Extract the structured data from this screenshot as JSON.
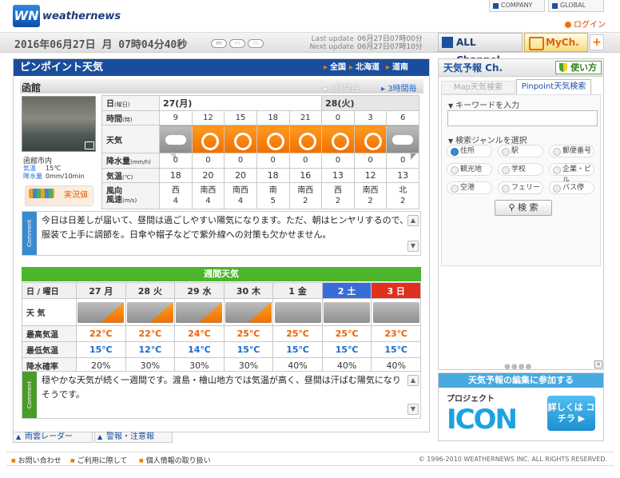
{
  "header": {
    "logo_mark": "WN",
    "logo_text": "weathernews",
    "company": "COMPANY",
    "global": "GLOBAL",
    "login": "ログイン"
  },
  "datebar": {
    "datetime": "2016年06月27日 月 07時04分40秒",
    "last_label": "Last update",
    "last_value": "06月27日07時00分",
    "next_label": "Next update",
    "next_value": "06月27日07時10分",
    "all_channel": "ALL Channel",
    "mych": "MyCh.",
    "plus": "+"
  },
  "pinpoint": {
    "title": "ピンポイント天気",
    "regions": [
      "全国",
      "北海道",
      "道南"
    ],
    "city": "函館",
    "tab_1h": "1時間毎",
    "tab_3h": "3時間毎",
    "location": "函館市内",
    "obs_temp_label": "気温",
    "obs_temp": "15℃",
    "obs_rain_label": "降水量",
    "obs_rain": "0mm/10min",
    "live_label": "実況値"
  },
  "hourly": {
    "labels": {
      "day": "日",
      "day_u": "(曜日)",
      "time": "時間",
      "time_u": "(時)",
      "weather": "天気",
      "rain": "降水量",
      "rain_u": "(mm/h)",
      "temp": "気温",
      "temp_u": "(℃)",
      "wind1": "風向",
      "wind2": "風速",
      "wind_u": "(m/s)"
    },
    "day1": "27(月)",
    "day2": "28(火)",
    "hours": [
      "9",
      "12",
      "15",
      "18",
      "21",
      "0",
      "3",
      "6"
    ],
    "weather": [
      "cloud",
      "sun",
      "sun",
      "sun",
      "sun",
      "sun",
      "sun",
      "cloud"
    ],
    "rain": [
      "0",
      "0",
      "0",
      "0",
      "0",
      "0",
      "0",
      "0"
    ],
    "temp": [
      "18",
      "20",
      "20",
      "18",
      "16",
      "13",
      "12",
      "13"
    ],
    "wind_dir": [
      "西",
      "南西",
      "南西",
      "南",
      "南西",
      "西",
      "南西",
      "北"
    ],
    "wind_speed": [
      "4",
      "4",
      "4",
      "5",
      "2",
      "2",
      "2",
      "2"
    ]
  },
  "comment1": {
    "label": "Comment",
    "text": "今日は日差しが届いて、昼間は過ごしやすい陽気になります。ただ、朝はヒンヤリするので、服装で上手に調節を。日傘や帽子などで紫外線への対策も欠かせません。"
  },
  "weekly": {
    "title": "週間天気",
    "labels": {
      "day": "日 / 曜日",
      "weather": "天 気",
      "high": "最高気温",
      "low": "最低気温",
      "rain": "降水確率"
    },
    "days": [
      "27 月",
      "28 火",
      "29 水",
      "30 木",
      "1 金",
      "2 土",
      "3 日"
    ],
    "weather": [
      "half",
      "half",
      "half",
      "half",
      "cloud",
      "cloud",
      "cloud"
    ],
    "high": [
      "22℃",
      "22℃",
      "24℃",
      "25℃",
      "25℃",
      "25℃",
      "23℃"
    ],
    "low": [
      "15℃",
      "12℃",
      "14℃",
      "15℃",
      "15℃",
      "15℃",
      "15℃"
    ],
    "rain": [
      "20%",
      "30%",
      "30%",
      "30%",
      "40%",
      "40%",
      "40%"
    ]
  },
  "comment2": {
    "label": "Comment",
    "text": "穏やかな天気が続く一週間です。渡島・檜山地方では気温が高く、昼間は汗ばむ陽気になりそうです。"
  },
  "bottom_links": [
    "雨雲レーダー",
    "警報・注意報"
  ],
  "sidebar": {
    "title": "天気予報 Ch.",
    "howto": "使い方",
    "tab_map": "Map天気検索",
    "tab_pinpoint": "Pinpoint天気検索",
    "keyword_label": "キーワードを入力",
    "genre_label": "検索ジャンルを選択",
    "genres": [
      "住所",
      "駅",
      "郵便番号",
      "観光地",
      "学校",
      "企業・ビル",
      "空港",
      "フェリー",
      "バス停"
    ],
    "search": "検 索",
    "dots": "●●●●"
  },
  "promo": {
    "title": "天気予報の編集に参加する",
    "project": "プロジェクト",
    "icon_word": "ICON",
    "more": "詳しくは コチラ ▶"
  },
  "footer": {
    "links": [
      "お問い合わせ",
      "ご利用に際して",
      "個人情報の取り扱い"
    ],
    "copyright": "© 1996-2010 WEATHERNEWS INC. ALL RIGHTS RESERVED."
  }
}
